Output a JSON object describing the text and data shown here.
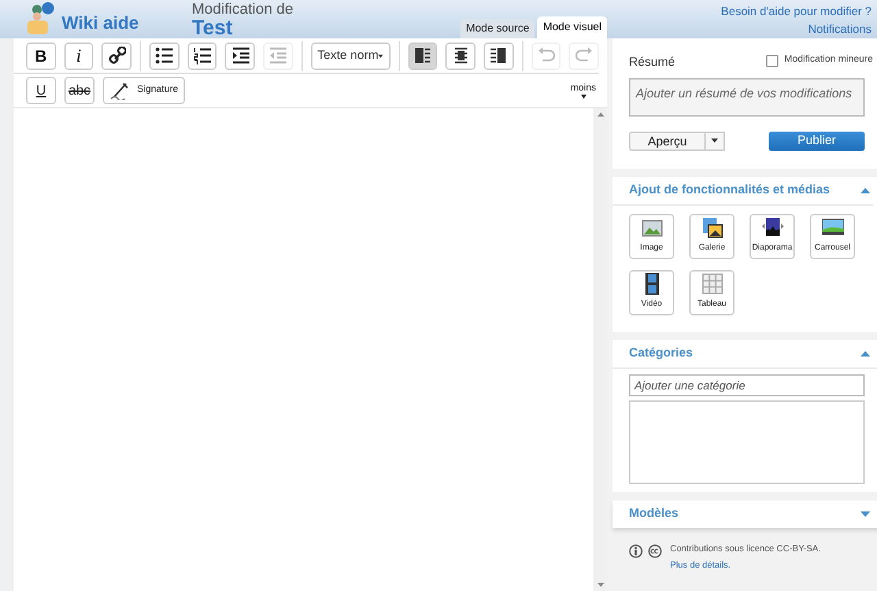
{
  "header": {
    "logo_text": "Wiki aide",
    "title_prefix": "Modification de",
    "title": "Test",
    "help_link": "Besoin d'aide pour modifier ?",
    "notifications": "Notifications"
  },
  "tabs": [
    {
      "label": "Mode source",
      "selected": false
    },
    {
      "label": "Mode visuel",
      "selected": true
    }
  ],
  "toolbar_row1": [
    {
      "kind": "text",
      "label": "B",
      "disabled": false,
      "selected": false
    },
    {
      "kind": "text",
      "label": "i",
      "disabled": false,
      "selected": false
    },
    {
      "kind": "icon",
      "disabled": false,
      "selected": false
    },
    {
      "kind": "icon",
      "disabled": false,
      "selected": false
    },
    {
      "kind": "icon",
      "disabled": false,
      "selected": false
    },
    {
      "kind": "icon",
      "disabled": false,
      "selected": false
    },
    {
      "kind": "icon",
      "disabled": true,
      "selected": false
    },
    {
      "kind": "select",
      "label": "Texte norm",
      "disabled": false,
      "selected": false
    },
    {
      "kind": "icon",
      "disabled": false,
      "selected": true
    },
    {
      "kind": "icon",
      "disabled": false,
      "selected": false
    },
    {
      "kind": "icon",
      "disabled": false,
      "selected": false
    },
    {
      "kind": "icon",
      "disabled": true,
      "selected": false
    },
    {
      "kind": "icon",
      "disabled": true,
      "selected": false
    }
  ],
  "toolbar_row2": [
    {
      "kind": "text",
      "label": "U"
    },
    {
      "kind": "text",
      "label": "abc"
    },
    {
      "kind": "icon_text",
      "label": "Signature"
    }
  ],
  "more_toggle": "moins",
  "summary": {
    "label": "Résumé",
    "placeholder": "Ajouter un résumé de vos modifications",
    "minor_edit_label": "Modification mineure",
    "minor_edit_checked": false
  },
  "preview_button": "Aperçu",
  "publish_button": "Publier",
  "sections": [
    {
      "kind": "media",
      "title": "Ajout de fonctionnalités et médias",
      "expanded": true,
      "items": [
        "Image",
        "Galerie",
        "Diaporama",
        "Carrousel",
        "Vidéo",
        "Tableau"
      ]
    },
    {
      "kind": "categories",
      "title": "Catégories",
      "expanded": true,
      "placeholder": "Ajouter une catégorie"
    },
    {
      "kind": "templates",
      "title": "Modèles",
      "expanded": false
    }
  ],
  "license": {
    "text": "Contributions sous licence CC-BY-SA.",
    "link": "Plus de détails."
  }
}
